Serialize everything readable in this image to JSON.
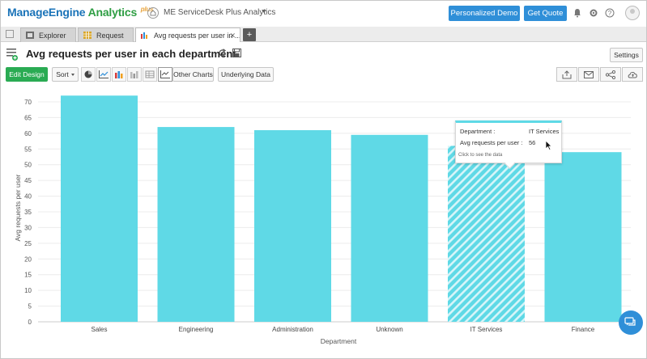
{
  "header": {
    "logo_brand": "ManageEngine",
    "logo_product": "Analytics",
    "logo_plus": "plus",
    "app_name": "ME ServiceDesk Plus Analytics",
    "demo_button": "Personalized Demo",
    "quote_button": "Get Quote"
  },
  "tabs": [
    {
      "label": "Explorer"
    },
    {
      "label": "Request"
    },
    {
      "label": "Avg requests per user in ..."
    }
  ],
  "report": {
    "title": "Avg requests per user in each department",
    "settings_label": "Settings"
  },
  "toolbar": {
    "edit_design": "Edit Design",
    "sort": "Sort",
    "other_charts": "Other Charts",
    "underlying_data": "Underlying Data"
  },
  "tooltip": {
    "dept_label": "Department :",
    "dept_value": "IT Services",
    "avg_label": "Avg requests per user :",
    "avg_value": "56",
    "hint": "Click to see the data"
  },
  "chart_data": {
    "type": "bar",
    "categories": [
      "Sales",
      "Engineering",
      "Administration",
      "Unknown",
      "IT Services",
      "Finance"
    ],
    "values": [
      72,
      62,
      61,
      59.5,
      56,
      54
    ],
    "xlabel": "Department",
    "ylabel": "Avg requests per user",
    "ylim": [
      0,
      70
    ],
    "yticks": [
      0,
      5,
      10,
      15,
      20,
      25,
      30,
      35,
      40,
      45,
      50,
      55,
      60,
      65,
      70
    ],
    "grid": true,
    "highlighted_category": "IT Services",
    "bar_color": "#5fd9e6"
  },
  "colors": {
    "accent": "#2f8fd8",
    "edit_green": "#2aab53",
    "bar": "#5fd9e6"
  }
}
